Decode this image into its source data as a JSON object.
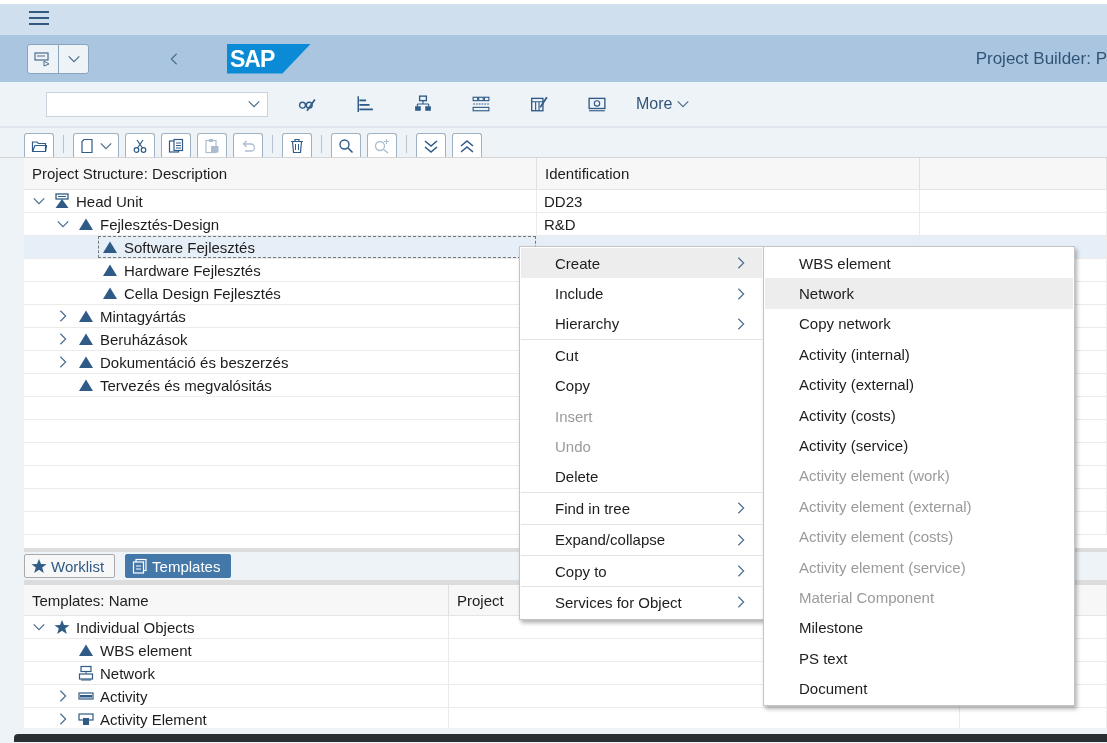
{
  "header": {
    "logo": "SAP",
    "title": "Project Builder: P"
  },
  "toolbar": {
    "icons": [
      {
        "kind": "glasses-pencil"
      },
      {
        "kind": "bar-list"
      },
      {
        "kind": "hierarchy"
      },
      {
        "kind": "grid"
      },
      {
        "kind": "table-pencil"
      },
      {
        "kind": "banknote"
      }
    ],
    "more": "More"
  },
  "icon_bar": {
    "groups": [
      [
        {
          "kind": "folder",
          "dropdown": false,
          "disabled": false
        }
      ],
      [
        {
          "kind": "page",
          "dropdown": true,
          "disabled": false
        },
        {
          "kind": "scissors",
          "dropdown": false,
          "disabled": false
        },
        {
          "kind": "copy",
          "dropdown": false,
          "disabled": false
        },
        {
          "kind": "clipboard",
          "dropdown": false,
          "disabled": true
        },
        {
          "kind": "undo",
          "dropdown": false,
          "disabled": true
        }
      ],
      [
        {
          "kind": "trash",
          "dropdown": false,
          "disabled": false
        }
      ],
      [
        {
          "kind": "search",
          "dropdown": false,
          "disabled": false
        },
        {
          "kind": "zoom-plus",
          "dropdown": false,
          "disabled": true
        }
      ],
      [
        {
          "kind": "double-down",
          "dropdown": false,
          "disabled": false
        },
        {
          "kind": "double-up",
          "dropdown": false,
          "disabled": false
        }
      ]
    ]
  },
  "structure": {
    "columns": [
      "Project Structure: Description",
      "Identification"
    ],
    "rows": [
      {
        "label": "Head Unit",
        "id": "DD23",
        "kind": "unit",
        "expanded": true,
        "selected": false,
        "children": [
          {
            "label": "Fejlesztés-Design",
            "id": "R&D",
            "kind": "wbs",
            "expanded": true,
            "selected": false,
            "children": [
              {
                "label": "Software Fejlesztés",
                "kind": "wbs",
                "selected": true
              },
              {
                "label": "Hardware Fejlesztés",
                "kind": "wbs",
                "selected": false
              },
              {
                "label": "Cella Design Fejlesztés",
                "kind": "wbs",
                "selected": false
              }
            ]
          },
          {
            "label": "Mintagyártás",
            "kind": "wbs",
            "expanded": false,
            "selected": false
          },
          {
            "label": "Beruházások",
            "kind": "wbs",
            "expanded": false,
            "selected": false
          },
          {
            "label": "Dokumentáció és beszerzés",
            "kind": "wbs",
            "expanded": false,
            "selected": false
          },
          {
            "label": "Tervezés és megvalósitás",
            "kind": "wbs",
            "selected": false
          }
        ]
      }
    ]
  },
  "panel_tabs": [
    {
      "label": "Worklist",
      "kind": "star",
      "selected": false
    },
    {
      "label": "Templates",
      "kind": "templates",
      "selected": true
    }
  ],
  "templates": {
    "columns": [
      "Templates: Name",
      "Project"
    ],
    "rows": [
      {
        "label": "Individual Objects",
        "kind": "star",
        "expanded": true,
        "children": [
          {
            "label": "WBS element",
            "kind": "wbs"
          },
          {
            "label": "Network",
            "kind": "network"
          },
          {
            "label": "Activity",
            "kind": "activity",
            "expanded": false
          },
          {
            "label": "Activity Element",
            "kind": "activity-element",
            "expanded": false
          }
        ]
      }
    ]
  },
  "context_menu": {
    "sections": [
      [
        {
          "label": "Create",
          "submenu": true,
          "disabled": false,
          "selected": true
        },
        {
          "label": "Include",
          "submenu": true,
          "disabled": false,
          "selected": false
        },
        {
          "label": "Hierarchy",
          "submenu": true,
          "disabled": false,
          "selected": false
        }
      ],
      [
        {
          "label": "Cut",
          "submenu": false,
          "disabled": false,
          "selected": false
        },
        {
          "label": "Copy",
          "submenu": false,
          "disabled": false,
          "selected": false
        },
        {
          "label": "Insert",
          "submenu": false,
          "disabled": true,
          "selected": false
        },
        {
          "label": "Undo",
          "submenu": false,
          "disabled": true,
          "selected": false
        },
        {
          "label": "Delete",
          "submenu": false,
          "disabled": false,
          "selected": false
        }
      ],
      [
        {
          "label": "Find in tree",
          "submenu": true,
          "disabled": false,
          "selected": false
        }
      ],
      [
        {
          "label": "Expand/collapse",
          "submenu": true,
          "disabled": false,
          "selected": false
        }
      ],
      [
        {
          "label": "Copy to",
          "submenu": true,
          "disabled": false,
          "selected": false
        }
      ],
      [
        {
          "label": "Services for Object",
          "submenu": true,
          "disabled": false,
          "selected": false
        }
      ]
    ]
  },
  "submenu": {
    "items": [
      {
        "label": "WBS element",
        "disabled": false,
        "selected": false
      },
      {
        "label": "Network",
        "disabled": false,
        "selected": true
      },
      {
        "label": "Copy network",
        "disabled": false,
        "selected": false
      },
      {
        "label": "Activity (internal)",
        "disabled": false,
        "selected": false
      },
      {
        "label": "Activity (external)",
        "disabled": false,
        "selected": false
      },
      {
        "label": "Activity (costs)",
        "disabled": false,
        "selected": false
      },
      {
        "label": "Activity (service)",
        "disabled": false,
        "selected": false
      },
      {
        "label": "Activity element (work)",
        "disabled": true,
        "selected": false
      },
      {
        "label": "Activity element (external)",
        "disabled": true,
        "selected": false
      },
      {
        "label": "Activity element (costs)",
        "disabled": true,
        "selected": false
      },
      {
        "label": "Activity element (service)",
        "disabled": true,
        "selected": false
      },
      {
        "label": "Material Component",
        "disabled": true,
        "selected": false
      },
      {
        "label": "Milestone",
        "disabled": false,
        "selected": false
      },
      {
        "label": "PS text",
        "disabled": false,
        "selected": false
      },
      {
        "label": "Document",
        "disabled": false,
        "selected": false
      }
    ]
  }
}
